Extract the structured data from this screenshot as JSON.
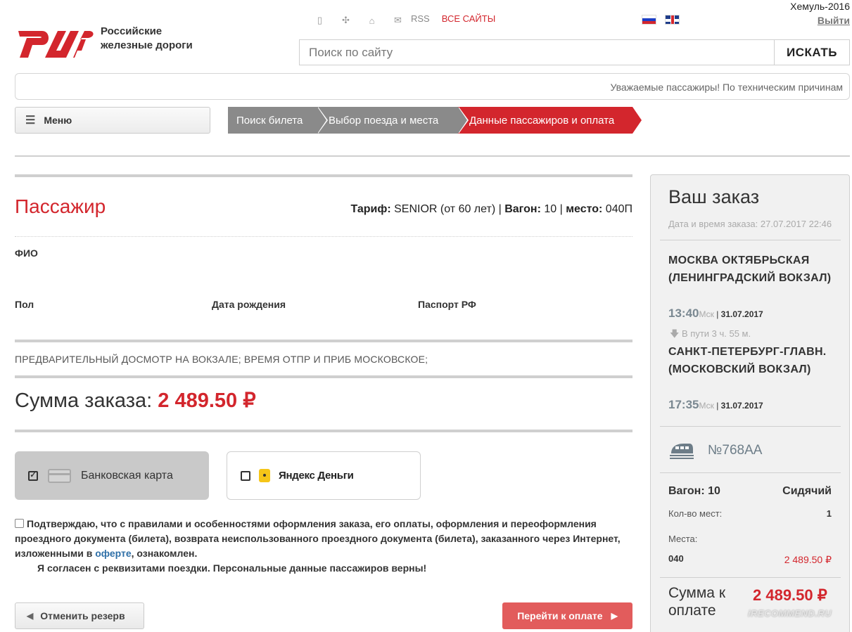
{
  "header": {
    "logo_line1": "Российские",
    "logo_line2": "железные дороги",
    "rss": "RSS",
    "all_sites": "ВСЕ САЙТЫ",
    "user_name": "Хемуль-2016",
    "logout": "Выйти",
    "icons": [
      "mobile-icon",
      "sitemap-icon",
      "home-icon",
      "mail-icon"
    ]
  },
  "search": {
    "placeholder": "Поиск по сайту",
    "button": "ИСКАТЬ"
  },
  "notice": "Уважаемые пассажиры! По техническим причинам",
  "menu": {
    "label": "Меню"
  },
  "steps": [
    {
      "label": "Поиск билета"
    },
    {
      "label": "Выбор поезда и места"
    },
    {
      "label": "Данные пассажиров и оплата"
    }
  ],
  "passenger": {
    "title": "Пассажир",
    "tariff_label": "Тариф:",
    "tariff_value": "SENIOR (от 60 лет)",
    "wagon_label": "Вагон:",
    "wagon_value": "10",
    "seat_label": "место:",
    "seat_value": "040П",
    "fio_label": "ФИО",
    "sex_label": "Пол",
    "birth_label": "Дата рождения",
    "passport_label": "Паспорт РФ"
  },
  "pre_note": "ПРЕДВАРИТЕЛЬНЫЙ ДОСМОТР НА ВОКЗАЛЕ; ВРЕМЯ ОТПР И ПРИБ МОСКОВСКОЕ;",
  "sum": {
    "label": "Сумма заказа:",
    "value": "2 489.50 ₽"
  },
  "payment": {
    "card_label": "Банковская карта",
    "yandex_label": "Яндекс Деньги"
  },
  "confirm": {
    "text_part1": "Подтверждаю, что с правилами и особенностями оформления заказа, его оплаты, оформления и переоформления проездного документа (билета), возврата неиспользованного проездного документа (билета), заказанного через Интернет, изложенными в ",
    "link": "оферте",
    "text_part2": ", ознакомлен.",
    "line2": "Я согласен с реквизитами поездки. Персональные данные пассажиров верны!"
  },
  "buttons": {
    "cancel": "Отменить резерв",
    "pay": "Перейти к оплате"
  },
  "order": {
    "title": "Ваш заказ",
    "date": "Дата и время заказа: 27.07.2017 22:46",
    "from_station": "МОСКВА ОКТЯБРЬСКАЯ (ЛЕНИНГРАДСКИЙ ВОКЗАЛ)",
    "dep_time": "13:40",
    "msk": "Мск",
    "dep_date": "31.07.2017",
    "on_way": "В пути 3 ч. 55 м.",
    "to_station": "САНКТ-ПЕТЕРБУРГ-ГЛАВН. (МОСКОВСКИЙ ВОКЗАЛ)",
    "arr_time": "17:35",
    "arr_date": "31.07.2017",
    "train_no": "№768АА",
    "wagon": "Вагон: 10",
    "wagon_type": "Сидячий",
    "seats_count_label": "Кол-во мест:",
    "seats_count": "1",
    "seats_label": "Места:",
    "seat": "040",
    "seat_price": "2 489.50 ₽",
    "pay_sum_label": "Сумма к оплате",
    "pay_sum_value": "2 489.50 ₽"
  },
  "watermark": "iRECOMMEND.RU",
  "colors": {
    "brand_red": "#d3262d",
    "step_grey": "#8a8a8a",
    "pay_button": "#e25c5c"
  }
}
